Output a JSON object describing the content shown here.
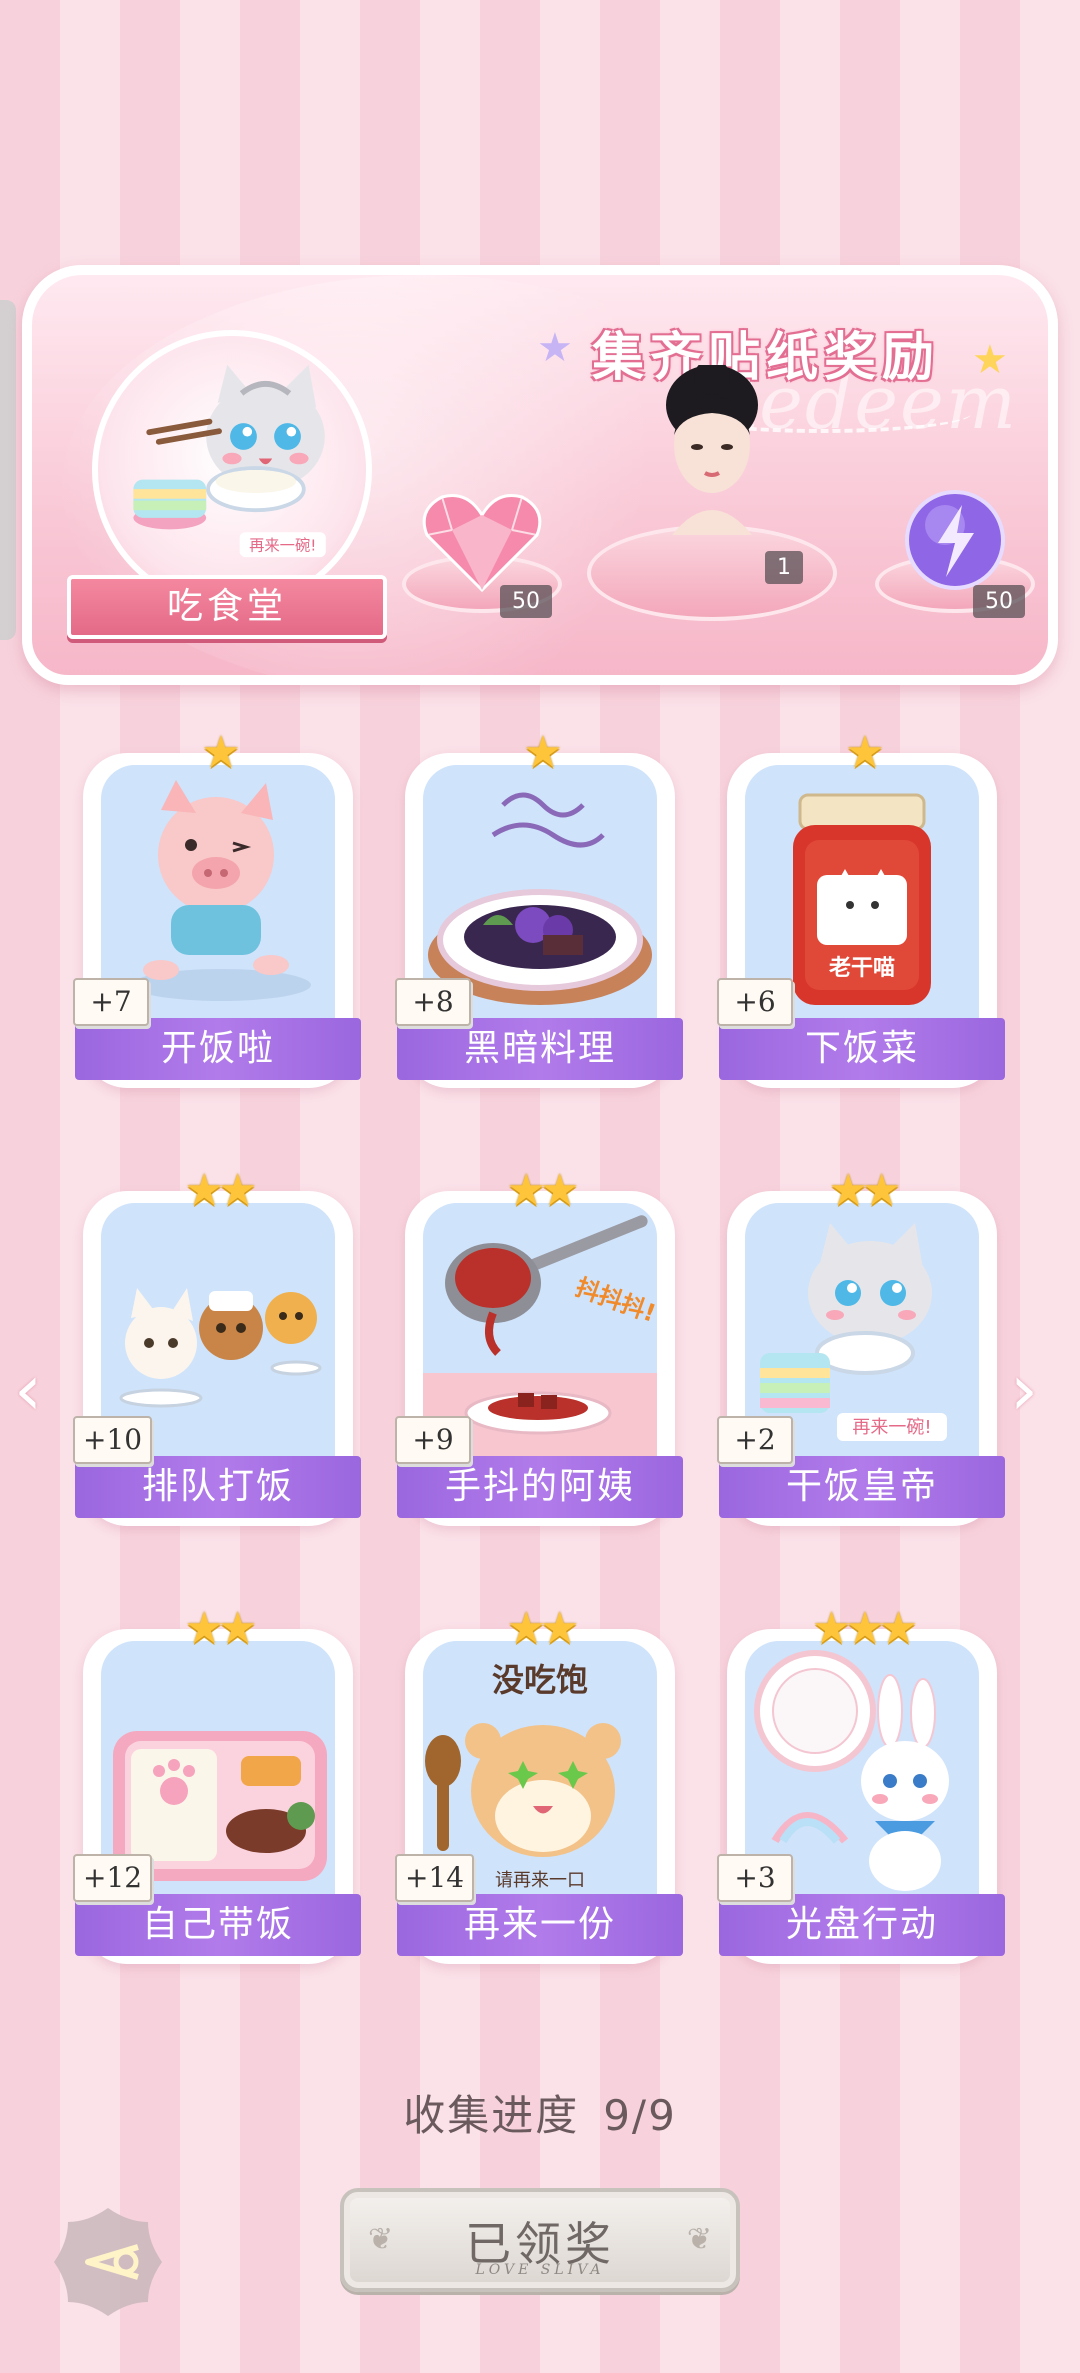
{
  "banner": {
    "title": "集齐贴纸奖励",
    "watermark": "Redeem",
    "medallion_label": "吃食堂",
    "medallion_badge": "再来一碗!",
    "rewards": [
      {
        "icon": "pink-heart-gem-icon",
        "count": "50"
      },
      {
        "icon": "character-portrait",
        "count": "1"
      },
      {
        "icon": "purple-lightning-orb-icon",
        "count": "50"
      }
    ]
  },
  "cards": [
    {
      "stars": "★",
      "bonus": "+7",
      "label": "开饭啦"
    },
    {
      "stars": "★",
      "bonus": "+8",
      "label": "黑暗料理"
    },
    {
      "stars": "★",
      "bonus": "+6",
      "label": "下饭菜",
      "jar_text": "老干喵"
    },
    {
      "stars": "★★",
      "bonus": "+10",
      "label": "排队打饭"
    },
    {
      "stars": "★★",
      "bonus": "+9",
      "label": "手抖的阿姨",
      "art_text": "抖抖抖!"
    },
    {
      "stars": "★★",
      "bonus": "+2",
      "label": "干饭皇帝",
      "art_text": "再来一碗!"
    },
    {
      "stars": "★★",
      "bonus": "+12",
      "label": "自己带饭"
    },
    {
      "stars": "★★",
      "bonus": "+14",
      "label": "再来一份",
      "art_text_top": "没吃饱",
      "art_text_bottom": "请再来一口"
    },
    {
      "stars": "★★★",
      "bonus": "+3",
      "label": "光盘行动"
    }
  ],
  "progress": {
    "label": "收集进度",
    "value": "9/9"
  },
  "claim_button": {
    "label": "已领奖",
    "sub": "LOVE SLIVA"
  },
  "colors": {
    "accent_purple": "#a36ee3",
    "star_gold": "#ffc53a",
    "banner_pink": "#e46a88"
  }
}
